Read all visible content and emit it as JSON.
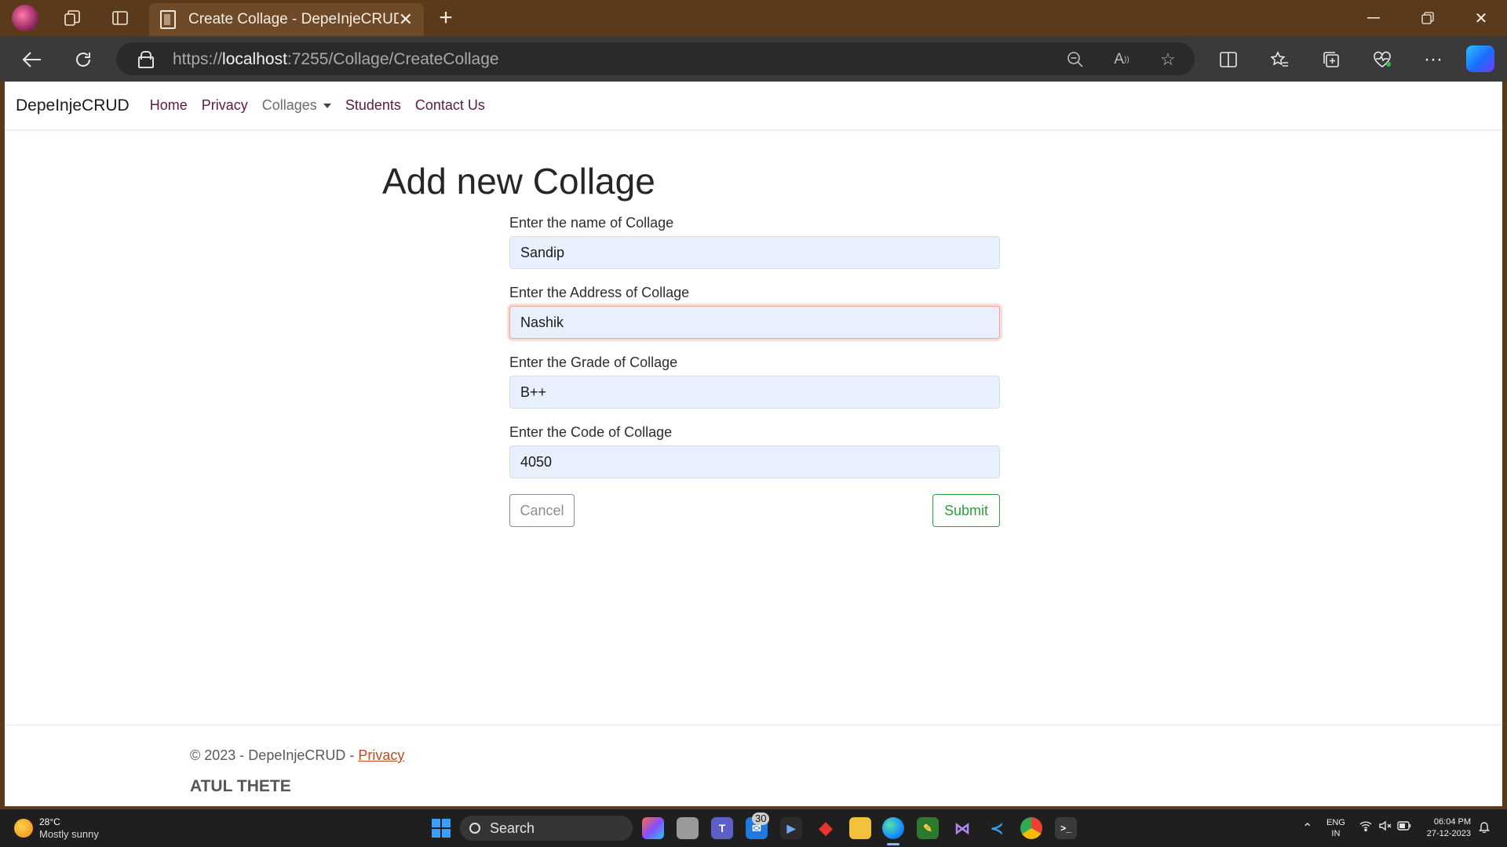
{
  "browser": {
    "tab_title": "Create Collage - DepeInjeCRUD",
    "url_prefix": "https://",
    "url_host": "localhost",
    "url_path": ":7255/Collage/CreateCollage"
  },
  "site": {
    "brand": "DepeInjeCRUD",
    "nav": {
      "home": "Home",
      "privacy": "Privacy",
      "collages": "Collages",
      "students": "Students",
      "contact": "Contact Us"
    }
  },
  "page": {
    "title": "Add new Collage"
  },
  "form": {
    "name": {
      "label": "Enter the name of Collage",
      "value": "Sandip"
    },
    "address": {
      "label": "Enter the Address of Collage",
      "value": "Nashik"
    },
    "grade": {
      "label": "Enter the Grade of Collage",
      "value": "B++"
    },
    "code": {
      "label": "Enter the Code of Collage",
      "value": "4050"
    },
    "cancel_label": "Cancel",
    "submit_label": "Submit"
  },
  "footer": {
    "copyright": "© 2023 - DepeInjeCRUD - ",
    "privacy_link": "Privacy",
    "author": "ATUL THETE"
  },
  "taskbar": {
    "temperature": "28°C",
    "weather": "Mostly sunny",
    "search_label": "Search",
    "mail_badge": "30",
    "lang_1": "ENG",
    "lang_2": "IN",
    "time": "06:04 PM",
    "date": "27-12-2023"
  },
  "colors": {
    "nav_link": "#5c1a44",
    "submit": "#2e9e3e",
    "input_bg": "#e8f0fe",
    "focus_border": "#f0a592"
  }
}
